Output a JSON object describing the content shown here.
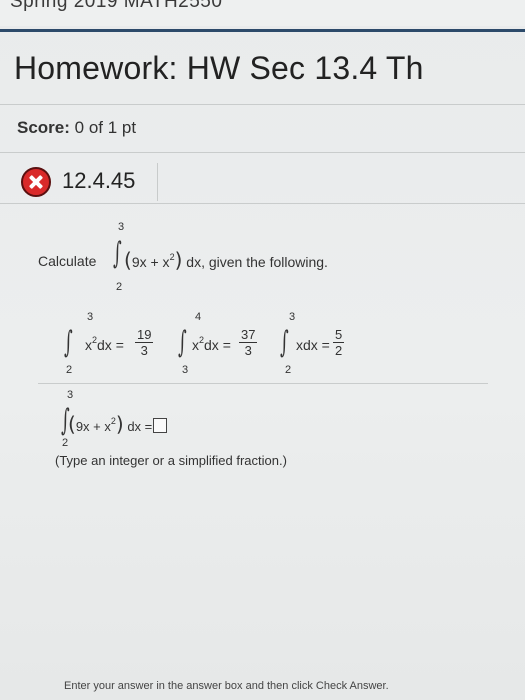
{
  "header": {
    "cut_text": "Spring 2019 MATH2550",
    "title": "Homework: HW Sec 13.4 Th"
  },
  "score": {
    "label": "Score:",
    "value": "0 of 1 pt"
  },
  "question": {
    "number": "12.4.45",
    "status": "incorrect"
  },
  "problem": {
    "calc_label": "Calculate",
    "upper": "3",
    "lower": "2",
    "integrand_a": "9x + x",
    "exp": "2",
    "dx": "dx",
    "suffix": ", given the following."
  },
  "givens": [
    {
      "upper": "3",
      "lower": "2",
      "integrand": "x",
      "exp": "2",
      "dx": "dx =",
      "num": "19",
      "den": "3"
    },
    {
      "upper": "4",
      "lower": "3",
      "integrand": "x",
      "exp": "2",
      "dx": "dx =",
      "num": "37",
      "den": "3"
    },
    {
      "upper": "3",
      "lower": "2",
      "integrand": "xdx =",
      "exp": "",
      "dx": "",
      "num": "5",
      "den": "2"
    }
  ],
  "answer": {
    "upper": "3",
    "lower": "2",
    "integrand_a": "9x + x",
    "exp": "2",
    "dx": "dx =",
    "hint": "(Type an integer or a simplified fraction.)"
  },
  "footer": {
    "text": "Enter your answer in the answer box and then click Check Answer."
  },
  "colors": {
    "incorrect": "#d92a2a",
    "accent_line": "#2c4a6a"
  }
}
